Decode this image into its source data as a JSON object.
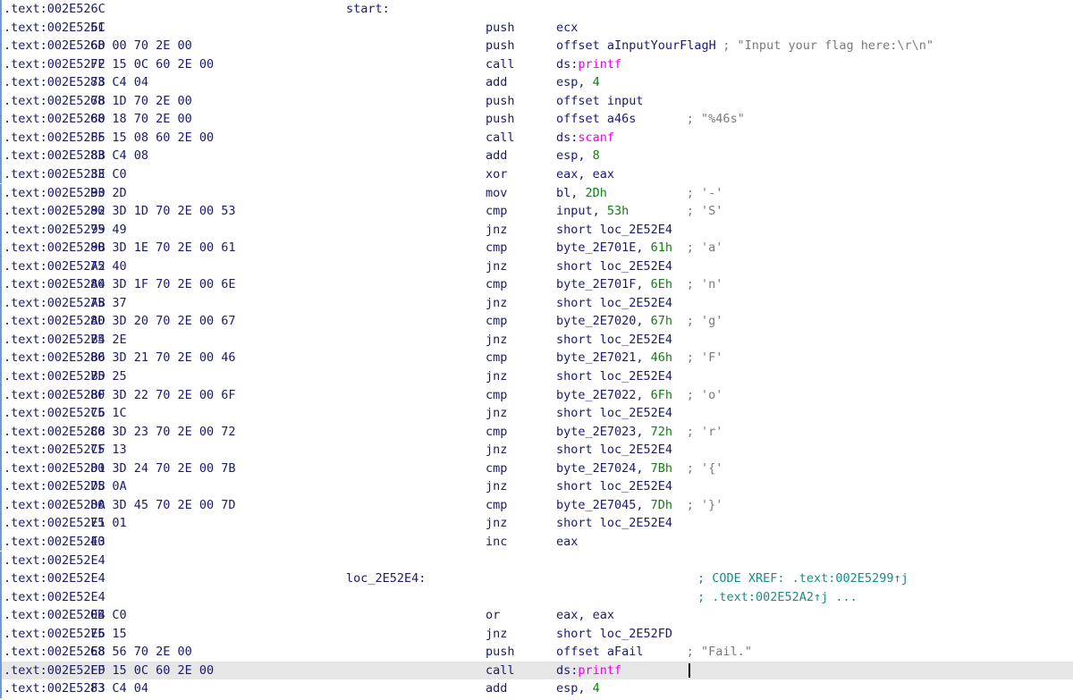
{
  "rows": [
    {
      "addr": ".text:002E526C",
      "bytes": "",
      "label": "start:",
      "mn": "",
      "ops": [],
      "cmt": ""
    },
    {
      "addr": ".text:002E526C",
      "bytes": "51",
      "label": "",
      "mn": "push",
      "ops": [
        {
          "t": "ecx"
        }
      ],
      "cmt": ""
    },
    {
      "addr": ".text:002E526D",
      "bytes": "68 00 70 2E 00",
      "label": "",
      "mn": "push",
      "ops": [
        {
          "t": "offset aInputYourFlagH"
        }
      ],
      "cmt": "; \"Input your flag here:\\r\\n\""
    },
    {
      "addr": ".text:002E5272",
      "bytes": "FF 15 0C 60 2E 00",
      "label": "",
      "mn": "call",
      "ops": [
        {
          "t": "ds:"
        },
        {
          "t": "printf",
          "c": "imp"
        }
      ],
      "cmt": ""
    },
    {
      "addr": ".text:002E5278",
      "bytes": "83 C4 04",
      "label": "",
      "mn": "add",
      "ops": [
        {
          "t": "esp, "
        },
        {
          "t": "4",
          "c": "num"
        }
      ],
      "cmt": ""
    },
    {
      "addr": ".text:002E527B",
      "bytes": "68 1D 70 2E 00",
      "label": "",
      "mn": "push",
      "ops": [
        {
          "t": "offset input"
        }
      ],
      "cmt": ""
    },
    {
      "addr": ".text:002E5280",
      "bytes": "68 18 70 2E 00",
      "label": "",
      "mn": "push",
      "ops": [
        {
          "t": "offset a46s"
        }
      ],
      "cmt": "; \"%46s\""
    },
    {
      "addr": ".text:002E5285",
      "bytes": "FF 15 08 60 2E 00",
      "label": "",
      "mn": "call",
      "ops": [
        {
          "t": "ds:"
        },
        {
          "t": "scanf",
          "c": "imp"
        }
      ],
      "cmt": ""
    },
    {
      "addr": ".text:002E528B",
      "bytes": "83 C4 08",
      "label": "",
      "mn": "add",
      "ops": [
        {
          "t": "esp, "
        },
        {
          "t": "8",
          "c": "num"
        }
      ],
      "cmt": ""
    },
    {
      "addr": ".text:002E528E",
      "bytes": "33 C0",
      "label": "",
      "mn": "xor",
      "ops": [
        {
          "t": "eax, eax"
        }
      ],
      "cmt": ""
    },
    {
      "addr": ".text:002E5290",
      "bytes": "B3 2D",
      "label": "",
      "mn": "mov",
      "ops": [
        {
          "t": "bl, "
        },
        {
          "t": "2Dh",
          "c": "num"
        }
      ],
      "cmt": "; '-'"
    },
    {
      "addr": ".text:002E5292",
      "bytes": "80 3D 1D 70 2E 00 53",
      "label": "",
      "mn": "cmp",
      "ops": [
        {
          "t": "input, "
        },
        {
          "t": "53h",
          "c": "num"
        }
      ],
      "cmt": "; 'S'"
    },
    {
      "addr": ".text:002E5299",
      "bytes": "75 49",
      "label": "",
      "mn": "jnz",
      "ops": [
        {
          "t": "short loc_2E52E4"
        }
      ],
      "cmt": ""
    },
    {
      "addr": ".text:002E529B",
      "bytes": "80 3D 1E 70 2E 00 61",
      "label": "",
      "mn": "cmp",
      "ops": [
        {
          "t": "byte_2E701E, "
        },
        {
          "t": "61h",
          "c": "num"
        }
      ],
      "cmt": "; 'a'"
    },
    {
      "addr": ".text:002E52A2",
      "bytes": "75 40",
      "label": "",
      "mn": "jnz",
      "ops": [
        {
          "t": "short loc_2E52E4"
        }
      ],
      "cmt": ""
    },
    {
      "addr": ".text:002E52A4",
      "bytes": "80 3D 1F 70 2E 00 6E",
      "label": "",
      "mn": "cmp",
      "ops": [
        {
          "t": "byte_2E701F, "
        },
        {
          "t": "6Eh",
          "c": "num"
        }
      ],
      "cmt": "; 'n'"
    },
    {
      "addr": ".text:002E52AB",
      "bytes": "75 37",
      "label": "",
      "mn": "jnz",
      "ops": [
        {
          "t": "short loc_2E52E4"
        }
      ],
      "cmt": ""
    },
    {
      "addr": ".text:002E52AD",
      "bytes": "80 3D 20 70 2E 00 67",
      "label": "",
      "mn": "cmp",
      "ops": [
        {
          "t": "byte_2E7020, "
        },
        {
          "t": "67h",
          "c": "num"
        }
      ],
      "cmt": "; 'g'"
    },
    {
      "addr": ".text:002E52B4",
      "bytes": "75 2E",
      "label": "",
      "mn": "jnz",
      "ops": [
        {
          "t": "short loc_2E52E4"
        }
      ],
      "cmt": ""
    },
    {
      "addr": ".text:002E52B6",
      "bytes": "80 3D 21 70 2E 00 46",
      "label": "",
      "mn": "cmp",
      "ops": [
        {
          "t": "byte_2E7021, "
        },
        {
          "t": "46h",
          "c": "num"
        }
      ],
      "cmt": "; 'F'"
    },
    {
      "addr": ".text:002E52BD",
      "bytes": "75 25",
      "label": "",
      "mn": "jnz",
      "ops": [
        {
          "t": "short loc_2E52E4"
        }
      ],
      "cmt": ""
    },
    {
      "addr": ".text:002E52BF",
      "bytes": "80 3D 22 70 2E 00 6F",
      "label": "",
      "mn": "cmp",
      "ops": [
        {
          "t": "byte_2E7022, "
        },
        {
          "t": "6Fh",
          "c": "num"
        }
      ],
      "cmt": "; 'o'"
    },
    {
      "addr": ".text:002E52C6",
      "bytes": "75 1C",
      "label": "",
      "mn": "jnz",
      "ops": [
        {
          "t": "short loc_2E52E4"
        }
      ],
      "cmt": ""
    },
    {
      "addr": ".text:002E52C8",
      "bytes": "80 3D 23 70 2E 00 72",
      "label": "",
      "mn": "cmp",
      "ops": [
        {
          "t": "byte_2E7023, "
        },
        {
          "t": "72h",
          "c": "num"
        }
      ],
      "cmt": "; 'r'"
    },
    {
      "addr": ".text:002E52CF",
      "bytes": "75 13",
      "label": "",
      "mn": "jnz",
      "ops": [
        {
          "t": "short loc_2E52E4"
        }
      ],
      "cmt": ""
    },
    {
      "addr": ".text:002E52D1",
      "bytes": "80 3D 24 70 2E 00 7B",
      "label": "",
      "mn": "cmp",
      "ops": [
        {
          "t": "byte_2E7024, "
        },
        {
          "t": "7Bh",
          "c": "num"
        }
      ],
      "cmt": "; '{'"
    },
    {
      "addr": ".text:002E52D8",
      "bytes": "75 0A",
      "label": "",
      "mn": "jnz",
      "ops": [
        {
          "t": "short loc_2E52E4"
        }
      ],
      "cmt": ""
    },
    {
      "addr": ".text:002E52DA",
      "bytes": "80 3D 45 70 2E 00 7D",
      "label": "",
      "mn": "cmp",
      "ops": [
        {
          "t": "byte_2E7045, "
        },
        {
          "t": "7Dh",
          "c": "num"
        }
      ],
      "cmt": "; '}'"
    },
    {
      "addr": ".text:002E52E1",
      "bytes": "75 01",
      "label": "",
      "mn": "jnz",
      "ops": [
        {
          "t": "short loc_2E52E4"
        }
      ],
      "cmt": ""
    },
    {
      "addr": ".text:002E52E3",
      "bytes": "40",
      "label": "",
      "mn": "inc",
      "ops": [
        {
          "t": "eax"
        }
      ],
      "cmt": ""
    },
    {
      "addr": ".text:002E52E4",
      "bytes": "",
      "label": "",
      "mn": "",
      "ops": [],
      "cmt": ""
    },
    {
      "addr": ".text:002E52E4",
      "bytes": "",
      "label": "loc_2E52E4:",
      "mn": "",
      "ops": [],
      "cmt": "; CODE XREF: .text:002E5299↑j",
      "xref": true
    },
    {
      "addr": ".text:002E52E4",
      "bytes": "",
      "label": "",
      "mn": "",
      "ops": [],
      "cmt": "; .text:002E52A2↑j ...",
      "xref": true
    },
    {
      "addr": ".text:002E52E4",
      "bytes": "0B C0",
      "label": "",
      "mn": "or",
      "ops": [
        {
          "t": "eax, eax"
        }
      ],
      "cmt": ""
    },
    {
      "addr": ".text:002E52E6",
      "bytes": "75 15",
      "label": "",
      "mn": "jnz",
      "ops": [
        {
          "t": "short loc_2E52FD"
        }
      ],
      "cmt": ""
    },
    {
      "addr": ".text:002E52E8",
      "bytes": "68 56 70 2E 00",
      "label": "",
      "mn": "push",
      "ops": [
        {
          "t": "offset aFail"
        }
      ],
      "cmt": "; \"Fail.\""
    },
    {
      "addr": ".text:002E52ED",
      "bytes": "FF 15 0C 60 2E 00",
      "label": "",
      "mn": "call",
      "ops": [
        {
          "t": "ds:"
        },
        {
          "t": "printf",
          "c": "imp"
        }
      ],
      "cmt": "",
      "highlight": true
    },
    {
      "addr": ".text:002E52F3",
      "bytes": "83 C4 04",
      "label": "",
      "mn": "add",
      "ops": [
        {
          "t": "esp, "
        },
        {
          "t": "4",
          "c": "num"
        }
      ],
      "cmt": ""
    }
  ]
}
